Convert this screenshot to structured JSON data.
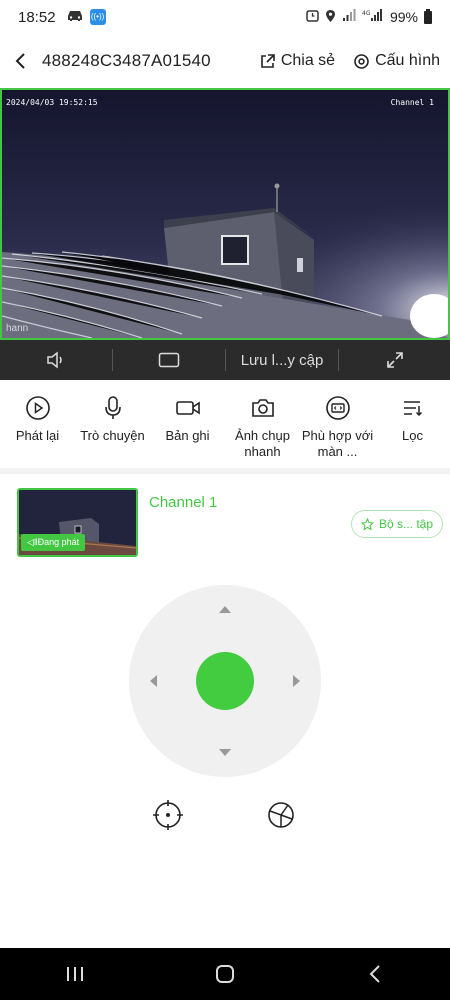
{
  "status_bar": {
    "time": "18:52",
    "battery": "99%",
    "left_icons": [
      "car-icon",
      "network-badge-icon"
    ],
    "right_icons": [
      "alarm-icon",
      "location-icon",
      "signal-icon",
      "signal-4g-icon",
      "battery-icon"
    ]
  },
  "header": {
    "title": "488248C3487A01540",
    "share_label": "Chia sẻ",
    "config_label": "Cấu hình"
  },
  "video": {
    "timestamp": "2024/04/03 19:52:15",
    "channel_osd": "Channel 1",
    "bottom_osd": "hann"
  },
  "video_toolbar": {
    "quality_label": "Lưu l...y cập"
  },
  "functions": [
    {
      "name": "playback",
      "label": "Phát lại"
    },
    {
      "name": "talk",
      "label": "Trò chuyện"
    },
    {
      "name": "record",
      "label": "Bản ghi"
    },
    {
      "name": "snapshot",
      "label": "Ảnh chụp nhanh"
    },
    {
      "name": "fit-screen",
      "label": "Phù hợp với màn ..."
    },
    {
      "name": "filter",
      "label": "Lọc"
    }
  ],
  "channel": {
    "name": "Channel 1",
    "playing_badge": "Đang phát",
    "favorite_label": "Bộ s... tập"
  },
  "colors": {
    "accent_green": "#43c743",
    "toolbar_dark": "#2b2b2b",
    "ptz_bg": "#f0f0f0"
  }
}
